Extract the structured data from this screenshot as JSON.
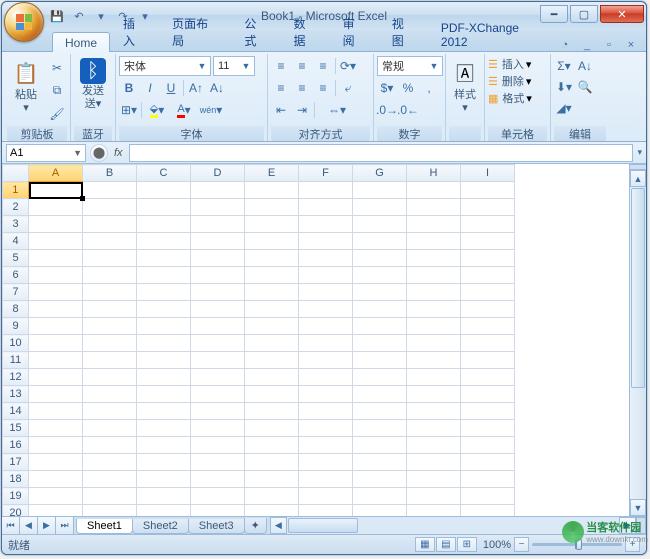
{
  "title": "Book1 - Microsoft Excel",
  "qat": {
    "save": "💾",
    "undo": "↶",
    "redo": "↷"
  },
  "tabs": [
    "Home",
    "插入",
    "页面布局",
    "公式",
    "数据",
    "审阅",
    "视图",
    "PDF-XChange 2012"
  ],
  "active_tab": 0,
  "ribbon": {
    "clipboard": {
      "paste": "粘贴",
      "label": "剪贴板"
    },
    "bluetooth": {
      "send": "发送",
      "label": "蓝牙"
    },
    "font": {
      "name": "宋体",
      "size": "11",
      "label": "字体",
      "bold": "B",
      "italic": "I",
      "underline": "U"
    },
    "alignment": {
      "label": "对齐方式"
    },
    "number": {
      "format": "常规",
      "label": "数字"
    },
    "styles": {
      "btn": "样式",
      "label": ""
    },
    "cells": {
      "insert": "插入",
      "delete": "删除",
      "format": "格式",
      "label": "单元格"
    },
    "editing": {
      "label": "编辑"
    }
  },
  "namebox": "A1",
  "formula": "",
  "cols": [
    "A",
    "B",
    "C",
    "D",
    "E",
    "F",
    "G",
    "H",
    "I"
  ],
  "rows": [
    "1",
    "2",
    "3",
    "4",
    "5",
    "6",
    "7",
    "8",
    "9",
    "10",
    "11",
    "12",
    "13",
    "14",
    "15",
    "16",
    "17",
    "18",
    "19",
    "20"
  ],
  "selected": {
    "col": 0,
    "row": 0
  },
  "sheet_tabs": [
    "Sheet1",
    "Sheet2",
    "Sheet3"
  ],
  "sheet_active": 0,
  "status": {
    "ready": "就绪",
    "zoom": "100%"
  },
  "watermark": {
    "text": "当客软件园",
    "url": "www.downkr.com"
  }
}
